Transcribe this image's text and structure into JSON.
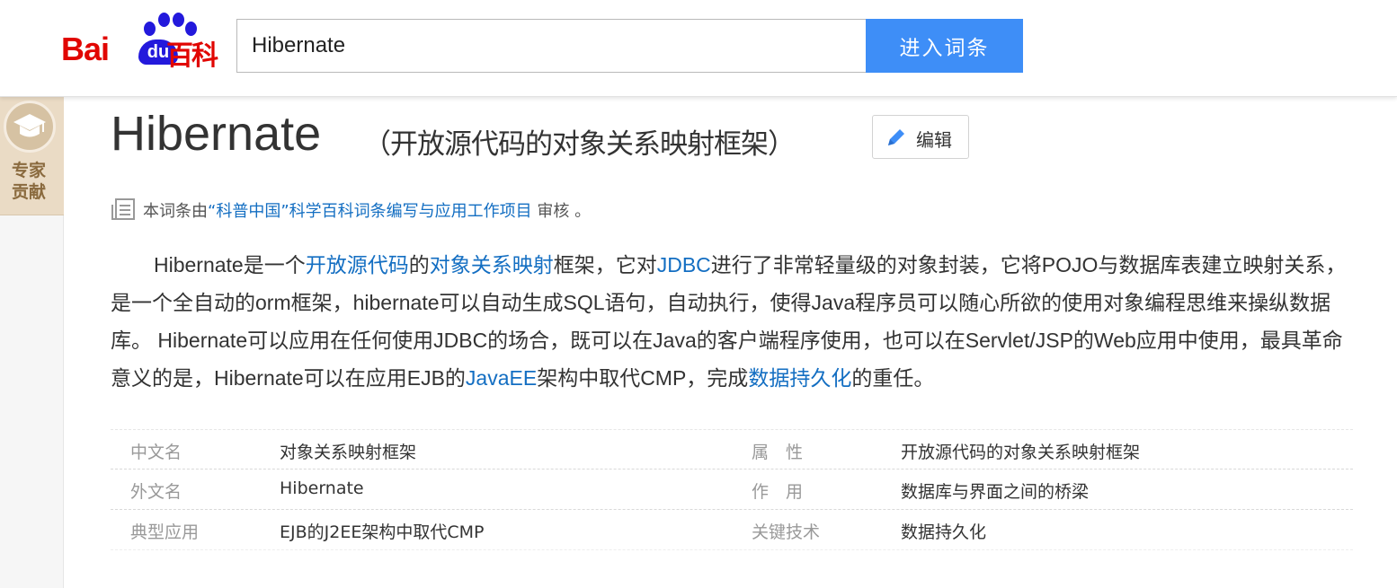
{
  "header": {
    "logo_text": "Baidu百科",
    "logo_bai": "Bai",
    "logo_du": "du",
    "logo_baike": "百科",
    "search_value": "Hibernate",
    "search_button": "进入词条"
  },
  "sidebar": {
    "expert_label_line1": "专家",
    "expert_label_line2": "贡献"
  },
  "article": {
    "title": "Hibernate",
    "subtitle": "（开放源代码的对象关系映射框架）",
    "edit_label": "编辑",
    "review": {
      "prefix": "本词条由",
      "org": "“科普中国”科学百科词条编写与应用工作项目",
      "suffix": "审核",
      "end": "。"
    },
    "summary": [
      {
        "text": "Hibernate是一个",
        "link": false
      },
      {
        "text": "开放源代码",
        "link": true
      },
      {
        "text": "的",
        "link": false
      },
      {
        "text": "对象关系映射",
        "link": true
      },
      {
        "text": "框架，它对",
        "link": false
      },
      {
        "text": "JDBC",
        "link": true
      },
      {
        "text": "进行了非常轻量级的对象封装，它将POJO与数据库表建立映射关系，是一个全自动的orm框架，hibernate可以自动生成SQL语句，自动执行，使得Java程序员可以随心所欲的使用对象编程思维来操纵数据库。 Hibernate可以应用在任何使用JDBC的场合，既可以在Java的客户端程序使用，也可以在Servlet/JSP的Web应用中使用，最具革命意义的是，Hibernate可以在应用EJB的",
        "link": false
      },
      {
        "text": "JavaEE",
        "link": true
      },
      {
        "text": "架构中取代CMP，完成",
        "link": false
      },
      {
        "text": "数据持久化",
        "link": true
      },
      {
        "text": "的重任。",
        "link": false
      }
    ],
    "basic_info": [
      {
        "k1": "中文名",
        "v1": "对象关系映射框架",
        "k2": "属　性",
        "v2": "开放源代码的对象关系映射框架",
        "v2_link": false
      },
      {
        "k1": "外文名",
        "v1": "Hibernate",
        "k2": "作　用",
        "v2": "数据库与界面之间的桥梁",
        "v2_link": false
      },
      {
        "k1": "典型应用",
        "v1": "EJB的J2EE架构中取代CMP",
        "k2": "关键技术",
        "v2": "数据持久化",
        "v2_link": true
      }
    ]
  },
  "colors": {
    "brand_red": "#e10602",
    "brand_blue": "#2319dc",
    "button_blue": "#3e8ef7",
    "link": "#136ec2"
  }
}
